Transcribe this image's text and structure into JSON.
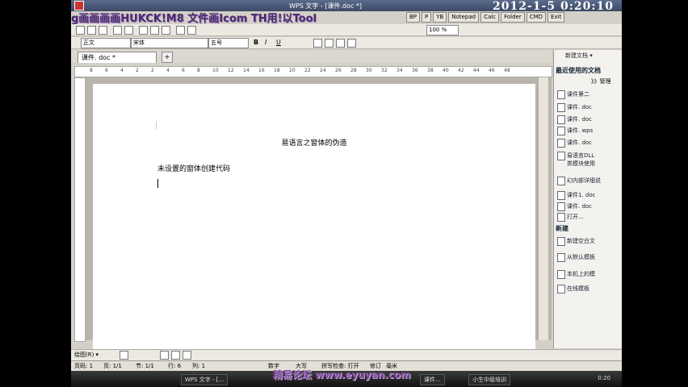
{
  "window": {
    "title": "WPS 文字 - [课件.doc *]",
    "clock": "2012-1-5 0:20:10"
  },
  "quickbar": [
    "BP",
    "P",
    "YB",
    "Notepad",
    "Calc",
    "Folder",
    "CMD",
    "Exit"
  ],
  "toolbar": {
    "style": "正文",
    "font": "宋体",
    "size": "五号",
    "zoom": "100 %",
    "bold": "B",
    "italic": "I",
    "underline": "U"
  },
  "tab": {
    "label": "课件. doc *"
  },
  "ruler": [
    "8",
    "6",
    "4",
    "2",
    "2",
    "4",
    "6",
    "8",
    "10",
    "12",
    "14",
    "16",
    "18",
    "20",
    "22",
    "24",
    "26",
    "28",
    "30",
    "32",
    "34",
    "36",
    "38",
    "40",
    "42",
    "44",
    "46",
    "48"
  ],
  "document": {
    "title": "易语言之窗体的伪造",
    "line1": "未设置的窗体创建代码"
  },
  "taskpane": {
    "header": "新建文档 ▾",
    "recent_heading": "最近使用的文档",
    "more": "》》管理",
    "recent": [
      "课件第二",
      "课件. doc",
      "课件. doc",
      "课件. wps",
      "课件. doc",
      "易语言DLL\n类模块使用",
      "幻内部详细说",
      "课件1. doc",
      "课件. doc",
      "打开..."
    ],
    "new_heading": "新建",
    "new_items": [
      "新建空白文",
      "从默认模板",
      "本机上的模",
      "在线模板"
    ]
  },
  "drawbar": {
    "label": "绘图(R) ▾"
  },
  "status": {
    "page": "页码: 1",
    "pages": "页: 1/1",
    "section": "节: 1/1",
    "row": "行: 6",
    "col": "列: 1",
    "mode1": "数字",
    "mode2": "大写",
    "spell": "拼写检查: 打开",
    "revise": "修订",
    "unit": "毫米"
  },
  "taskbar": [
    "WPS 文字 - [...",
    "课件...",
    "小生中级培训"
  ],
  "taskbar_time": "0:20",
  "watermarks": {
    "top": "g画画画画HUKCK!M8 文件画Icom TH用!以Tool",
    "bottom": "精易论坛 www.eyuyan.com"
  }
}
